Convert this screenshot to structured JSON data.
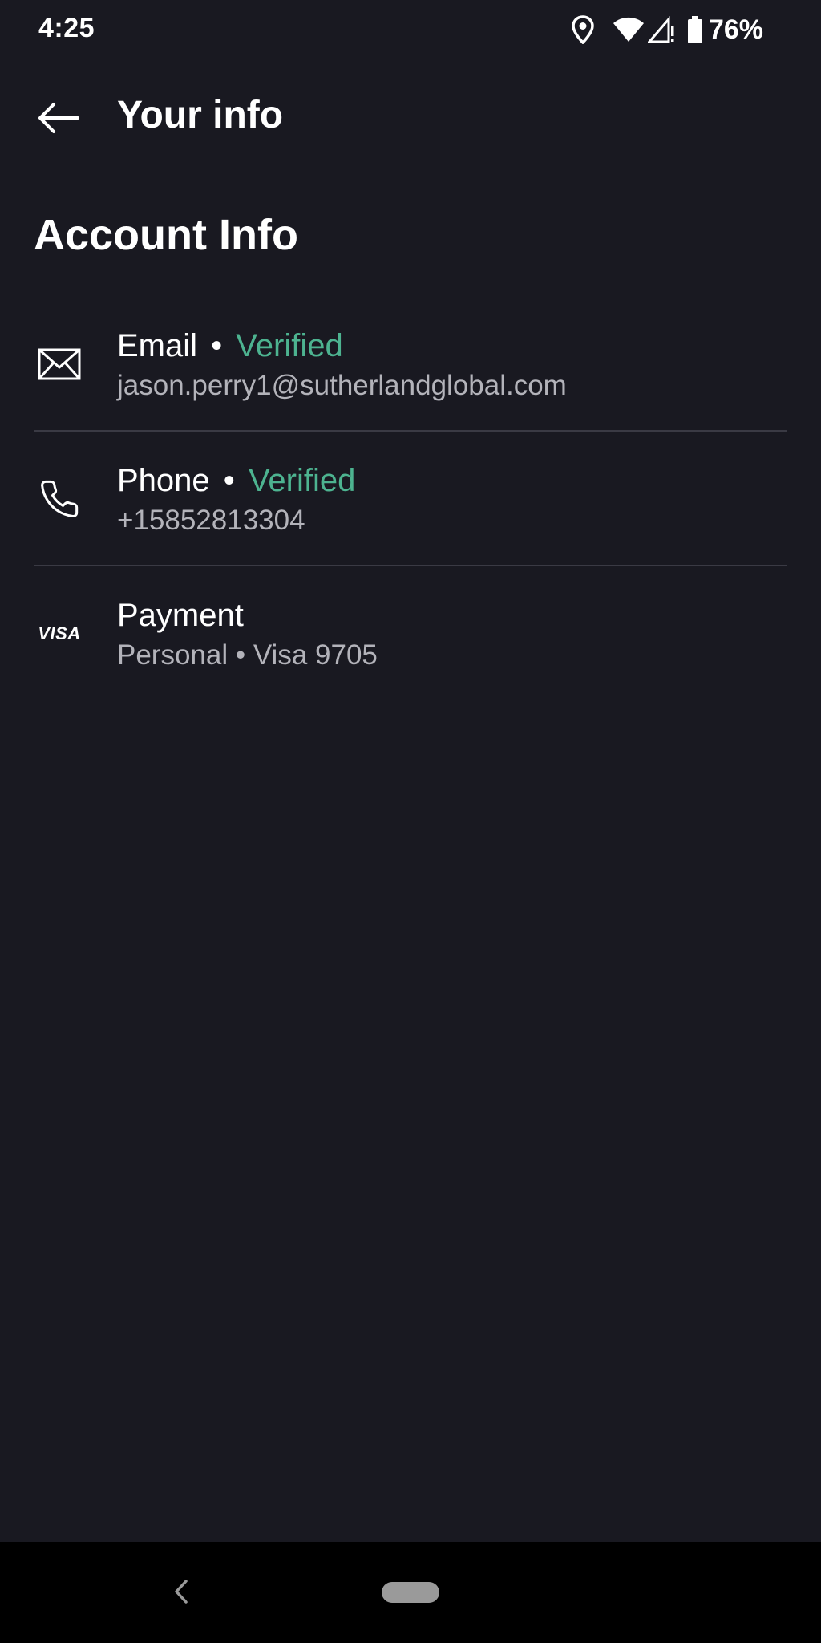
{
  "status_bar": {
    "time": "4:25",
    "battery": "76%",
    "icons": [
      "location-icon",
      "wifi-icon",
      "cell-signal-icon",
      "battery-icon"
    ]
  },
  "app_bar": {
    "title": "Your info",
    "back_icon": "arrow-left-icon"
  },
  "section": {
    "title": "Account Info"
  },
  "rows": [
    {
      "icon": "envelope-icon",
      "title": "Email",
      "separator": "•",
      "status": "Verified",
      "subtitle": "jason.perry1@sutherlandglobal.com"
    },
    {
      "icon": "phone-icon",
      "title": "Phone",
      "separator": "•",
      "status": "Verified",
      "subtitle": "+15852813304"
    },
    {
      "icon": "visa-logo",
      "logo_text": "VISA",
      "title": "Payment",
      "subtitle": "Personal • Visa 9705"
    }
  ],
  "colors": {
    "background": "#191921",
    "verified": "#4db390",
    "subtitle": "#b3b3ba",
    "divider": "#3a3a44",
    "nav_bar": "#000000"
  },
  "nav_bar": {
    "icons": [
      "nav-back-icon",
      "home-pill"
    ]
  }
}
